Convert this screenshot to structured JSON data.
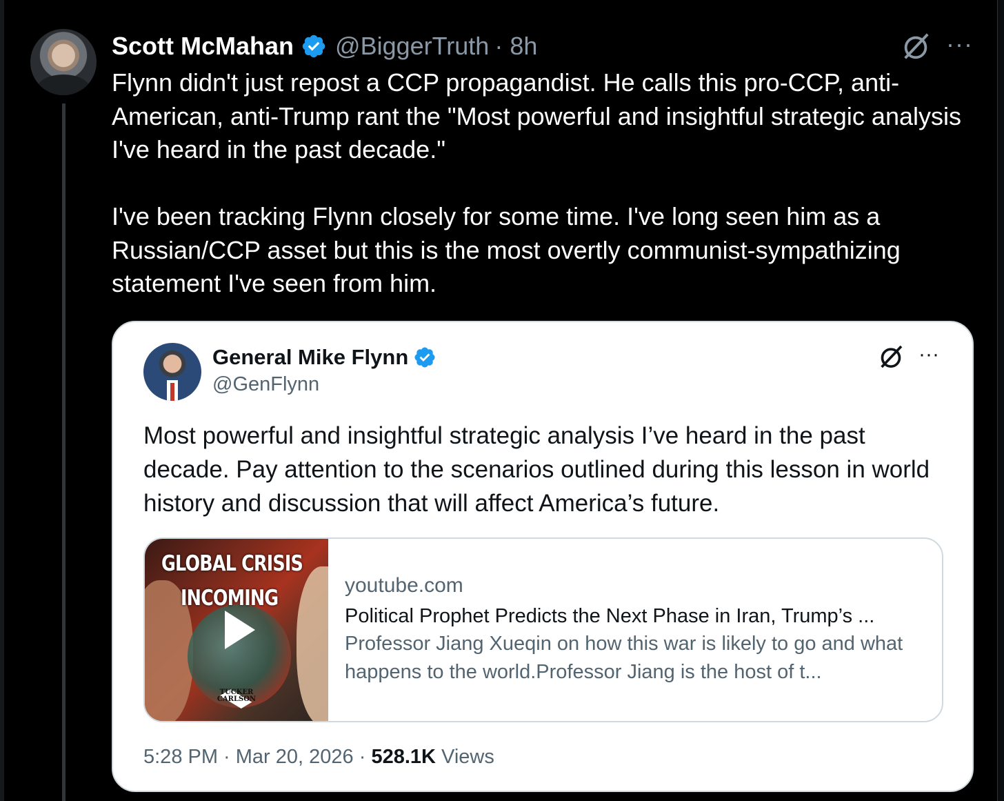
{
  "tweet": {
    "author_name": "Scott McMahan",
    "handle": "@BiggerTruth",
    "time": "· 8h",
    "text": "Flynn didn't just repost a CCP propagandist. He calls this pro-CCP, anti-American, anti-Trump rant the \"Most powerful and insightful strategic analysis I've heard in the past decade.\"\n\nI've been tracking Flynn closely for some time. I've long seen him as a Russian/CCP asset but this is the most overtly communist-sympathizing statement I've seen from him.",
    "more_label": "···"
  },
  "quote": {
    "author_name": "General Mike Flynn",
    "handle": "@GenFlynn",
    "more_label": "···",
    "text": "Most powerful and insightful strategic analysis I’ve heard in the past decade. Pay attention to the scenarios outlined during this lesson in world history and discussion that will affect America’s future.",
    "card": {
      "thumb_line1": "GLOBAL CRISIS",
      "thumb_line2": "INCOMING",
      "thumb_logo": "TUCKER CARLSON",
      "domain": "youtube.com",
      "title": "Political Prophet Predicts the Next Phase in Iran, Trump’s ...",
      "description": "Professor Jiang Xueqin on how this war is likely to go and what happens to the world.Professor Jiang is the host of t..."
    },
    "timestamp": "5:28 PM · Mar 20, 2026 ·",
    "views_count": "528.1K",
    "views_label": "Views"
  },
  "colors": {
    "background": "#000000",
    "verified_blue": "#1d9bf0",
    "secondary_text": "#8b98a5",
    "quote_background": "#ffffff"
  },
  "icons": [
    "verified-badge-icon",
    "grok-icon",
    "more-icon",
    "play-icon"
  ]
}
